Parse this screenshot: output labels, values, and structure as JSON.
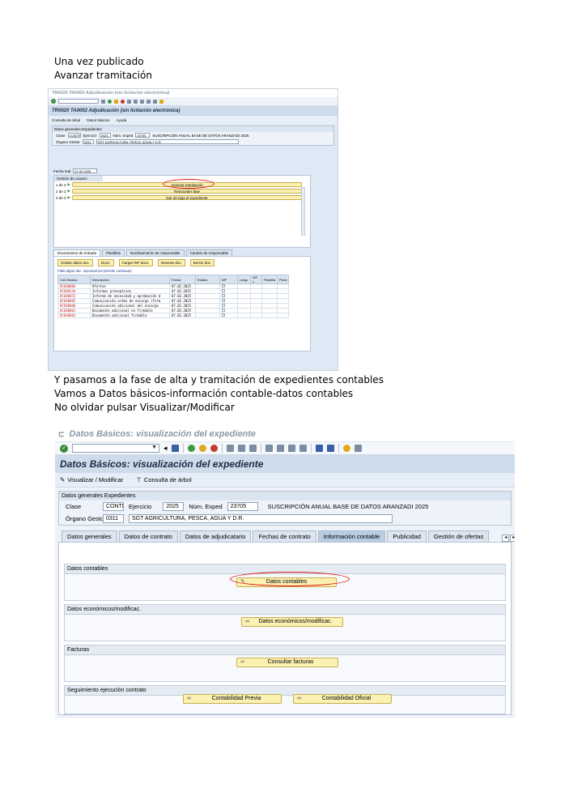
{
  "intro_lines": [
    "Una vez publicado",
    "Avanzar tramitación"
  ],
  "middle_lines": [
    "Y pasamos a la fase de alta y tramitación de expedientes contables",
    "Vamos a Datos básicos-información contable-datos contables",
    "No olvidar pulsar Visualizar/Modificar"
  ],
  "shot1": {
    "window_title": "TR0020 TA0002 Adjudicación (sin licitación electrónica)",
    "header": "TR0020 TA0002 Adjudicación (sin licitación electrónica)",
    "app_toolbar": [
      "Consulta de árbol",
      "Datos básicos",
      "Ayuda"
    ],
    "group_title": "Datos generales Expedientes",
    "clase_label": "Clase",
    "clase_value": "CONTR",
    "ejercicio_label": "Ejercicio",
    "ejercicio_value": "2025",
    "num_label": "Núm. Exped",
    "num_value": "23705",
    "descripcion": "SUSCRIPCIÓN ANUAL BASE DE DATOS ARANZADI 2025",
    "organo_label": "Órgano Gestor",
    "organo_value": "0311",
    "organo_desc": "SGT AGRICULTURA, PESCA, AGUA Y D.R.",
    "fecha_label": "Fecha real",
    "fecha_value": "07.02.2025",
    "gestion_title": "Gestión de usuario",
    "gestion_rows": [
      {
        "idx": "1 de 3",
        "label": "Avanzar tramitación"
      },
      {
        "idx": "2 de 3",
        "label": "Retroceder fase"
      },
      {
        "idx": "3 de 3",
        "label": "Dar de baja el expediente"
      }
    ],
    "tabs": [
      "Documentos de entrada",
      "Plantillas",
      "Nombramiento de responsable",
      "Cambio de responsable"
    ],
    "doc_buttons": [
      "Grabar datos doc.",
      "Docs.",
      "Cargar WF docs.",
      "Generar doc.",
      "Borrar doc."
    ],
    "doc_note": "Falta algún doc. Opcional  (es permite continuar)",
    "table_headers": [
      "Cód Módulo",
      "Descripción",
      "Fecha",
      "Estado",
      "WF",
      "Largo",
      "WF L.",
      "Plantilla",
      "Pend"
    ],
    "table_rows": [
      {
        "code": "DCE00006",
        "desc": "Ofertas",
        "date": "07.02.2025"
      },
      {
        "code": "DCE00144",
        "desc": "Informes preceptivos",
        "date": "07.02.2025"
      },
      {
        "code": "DCE00052",
        "desc": "Informe de necesidad y aprobación d",
        "date": "07.02.2025"
      },
      {
        "code": "DCE00005",
        "desc": "Comunicación orden de encargo (form",
        "date": "07.02.2025"
      },
      {
        "code": "DCE00006",
        "desc": "Comunicación adicional del encargo",
        "date": "07.02.2025"
      },
      {
        "code": "DCE00001",
        "desc": "Documento adicional no firmable",
        "date": "07.02.2025"
      },
      {
        "code": "DCE00002",
        "desc": "Documento adicional firmable",
        "date": "07.02.2025"
      }
    ]
  },
  "shot2": {
    "window_title": "Datos Básicos: visualización del expediente",
    "header": "Datos Básicos: visualización del expediente",
    "app_toolbar": [
      "Visualizar / Modificar",
      "Consulta de árbol"
    ],
    "group_title": "Datos generales Expedientes",
    "clase_label": "Clase",
    "clase_value": "CONTR",
    "ejercicio_label": "Ejercicio",
    "ejercicio_value": "2025",
    "num_label": "Núm. Exped",
    "num_value": "23705",
    "descripcion": "SUSCRIPCIÓN ANUAL BASE DE DATOS ARANZADI 2025",
    "organo_label": "Órgano Gestor",
    "organo_value": "0311",
    "organo_desc": "SGT AGRICULTURA, PESCA, AGUA Y D.R.",
    "tabs": [
      "Datos generales",
      "Datos de contrato",
      "Datos de adjudicatario",
      "Fechas de contrato",
      "Información contable",
      "Publicidad",
      "Gestión de ofertas"
    ],
    "active_tab": "Información contable",
    "sections": {
      "contables_title": "Datos contables",
      "contables_button": "Datos contables",
      "economicos_title": "Datos económicos/modificac.",
      "economicos_button": "Datos económicos/modificac.",
      "facturas_title": "Facturas",
      "facturas_button": "Consultar facturas",
      "seguimiento_title": "Seguimiento ejecución contrato",
      "previa_button": "Contabilidad Previa",
      "oficial_button": "Contabilidad Oficial"
    }
  },
  "colors": {
    "highlight_ellipse": "#e01414",
    "button_yellow": "#fbf1b3",
    "sap_header": "#cddbeb"
  }
}
